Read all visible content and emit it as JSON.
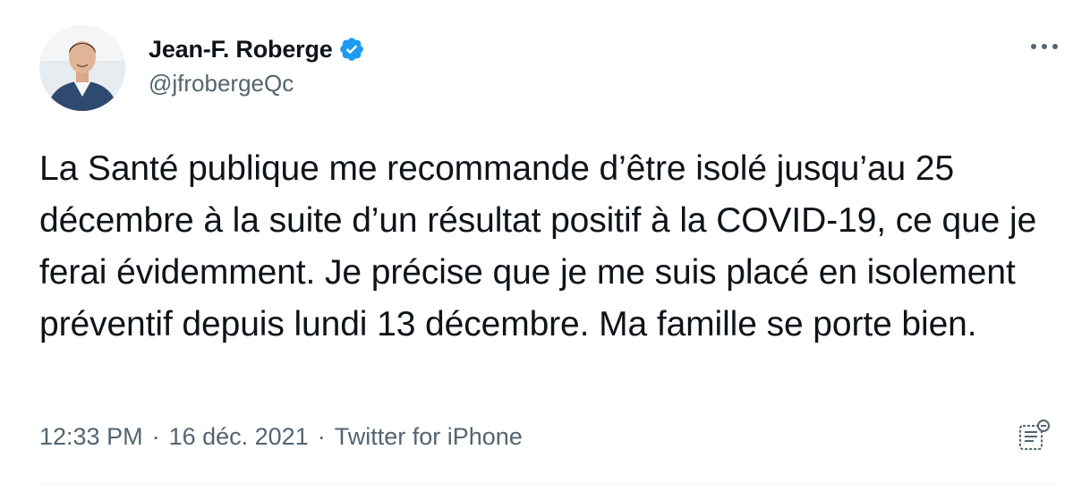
{
  "author": {
    "display_name": "Jean-F. Roberge",
    "handle": "@jfrobergeQc",
    "verified": true
  },
  "tweet": {
    "text": "La Santé publique me recommande d’être isolé jusqu’au 25 décembre à la suite d’un résultat positif à la COVID-19, ce que je ferai évidemment. Je précise que je me suis placé en isolement préventif depuis lundi 13 décembre. Ma famille se porte bien.",
    "time": "12:33 PM",
    "date": "16 déc. 2021",
    "source": "Twitter for iPhone",
    "separator": "·"
  },
  "icons": {
    "verified": "verified-badge-icon",
    "more": "more-options-icon",
    "document": "document-icon"
  },
  "colors": {
    "text_primary": "#0f1419",
    "text_secondary": "#536471",
    "verified_blue": "#1d9bf0"
  }
}
